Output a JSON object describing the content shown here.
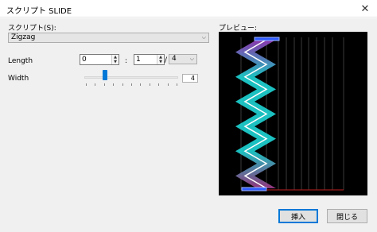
{
  "window": {
    "title": "スクリプト SLIDE",
    "close_glyph": "✕"
  },
  "script": {
    "label": "スクリプト(S):",
    "selected": "Zigzag"
  },
  "length": {
    "label": "Length",
    "first_value": "0",
    "separator": ":",
    "second_value": "1",
    "slash": "/",
    "denominator": "4"
  },
  "width": {
    "label": "Width",
    "value": "4",
    "slider_fraction": 0.22
  },
  "preview": {
    "label": "プレビュー:"
  },
  "buttons": {
    "insert": "挿入",
    "close": "閉じる"
  },
  "colors": {
    "zigzag_top": "#9b3bbf",
    "zigzag_mid": "#1fd5d5",
    "zigzag_bottom": "#a23a8a",
    "line": "#ffffff",
    "marker": "#2f5bff",
    "grid": "#3a3a3a",
    "red_line": "#c02020"
  }
}
